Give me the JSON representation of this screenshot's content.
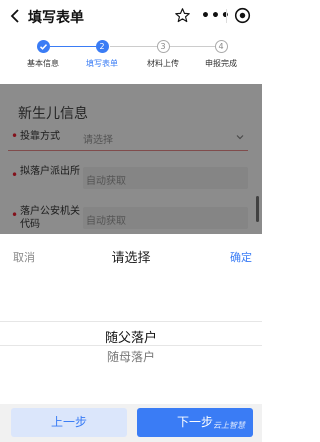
{
  "header": {
    "title": "填写表单",
    "icons": [
      "back-icon",
      "star-icon",
      "more-icon",
      "target-icon"
    ]
  },
  "stepper": {
    "steps": [
      {
        "index": "",
        "label": "基本信息",
        "state": "done"
      },
      {
        "index": "2",
        "label": "填写表单",
        "state": "current"
      },
      {
        "index": "3",
        "label": "材料上传",
        "state": "todo"
      },
      {
        "index": "4",
        "label": "申报完成",
        "state": "todo"
      }
    ]
  },
  "form": {
    "section_title": "新生儿信息",
    "fields": [
      {
        "label": "投靠方式",
        "value": "请选择",
        "required": true
      },
      {
        "label": "拟落户派出所",
        "value": "自动获取",
        "required": true
      },
      {
        "label": "落户公安机关代码",
        "value": "自动获取",
        "required": true
      }
    ]
  },
  "picker": {
    "cancel": "取消",
    "title": "请选择",
    "confirm": "确定",
    "options": [
      "随父落户",
      "随母落户"
    ],
    "selected": "随父落户"
  },
  "footer": {
    "prev": "上一步",
    "next": "下一步"
  },
  "watermark": "云上智慧",
  "colors": {
    "accent": "#3a7cf5",
    "required": "#e23333",
    "prev_bg": "#dbe6fb"
  }
}
